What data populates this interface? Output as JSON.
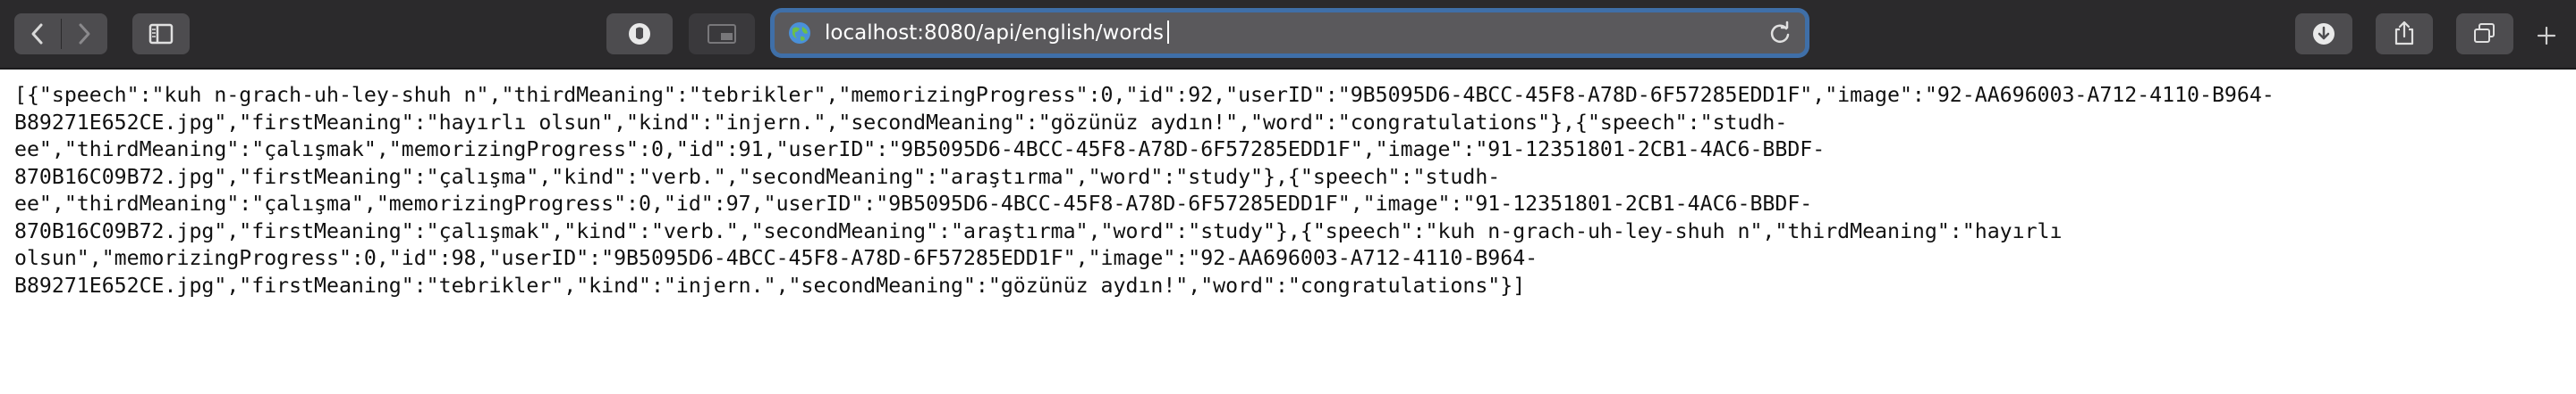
{
  "toolbar": {
    "back_icon": "chevron-left-icon",
    "forward_icon": "chevron-right-icon",
    "sidebar_icon": "sidebar-icon",
    "reader_icon": "privacy-icon",
    "pip_icon": "picture-in-picture-icon",
    "download_icon": "download-icon",
    "share_icon": "share-icon",
    "tabs_icon": "tab-overview-icon",
    "new_tab_icon": "plus-icon",
    "accent": "#3f6fa8"
  },
  "address_bar": {
    "url": "localhost:8080/api/english/words",
    "site_icon": "globe-icon",
    "reload_icon": "reload-icon"
  },
  "page": {
    "lines": [
      "[{\"speech\":\"kuh n-grach-uh-ley-shuh n\",\"thirdMeaning\":\"tebrikler\",\"memorizingProgress\":0,\"id\":92,\"userID\":\"9B5095D6-4BCC-45F8-A78D-6F57285EDD1F\",\"image\":\"92-AA696003-A712-4110-B964-",
      "B89271E652CE.jpg\",\"firstMeaning\":\"hayırlı olsun\",\"kind\":\"injern.\",\"secondMeaning\":\"gözünüz aydın!\",\"word\":\"congratulations\"},{\"speech\":\"studh-",
      "ee\",\"thirdMeaning\":\"çalışmak\",\"memorizingProgress\":0,\"id\":91,\"userID\":\"9B5095D6-4BCC-45F8-A78D-6F57285EDD1F\",\"image\":\"91-12351801-2CB1-4AC6-BBDF-",
      "870B16C09B72.jpg\",\"firstMeaning\":\"çalışma\",\"kind\":\"verb.\",\"secondMeaning\":\"araştırma\",\"word\":\"study\"},{\"speech\":\"studh-",
      "ee\",\"thirdMeaning\":\"çalışma\",\"memorizingProgress\":0,\"id\":97,\"userID\":\"9B5095D6-4BCC-45F8-A78D-6F57285EDD1F\",\"image\":\"91-12351801-2CB1-4AC6-BBDF-",
      "870B16C09B72.jpg\",\"firstMeaning\":\"çalışmak\",\"kind\":\"verb.\",\"secondMeaning\":\"araştırma\",\"word\":\"study\"},{\"speech\":\"kuh n-grach-uh-ley-shuh n\",\"thirdMeaning\":\"hayırlı",
      "olsun\",\"memorizingProgress\":0,\"id\":98,\"userID\":\"9B5095D6-4BCC-45F8-A78D-6F57285EDD1F\",\"image\":\"92-AA696003-A712-4110-B964-",
      "B89271E652CE.jpg\",\"firstMeaning\":\"tebrikler\",\"kind\":\"injern.\",\"secondMeaning\":\"gözünüz aydın!\",\"word\":\"congratulations\"}]"
    ]
  }
}
